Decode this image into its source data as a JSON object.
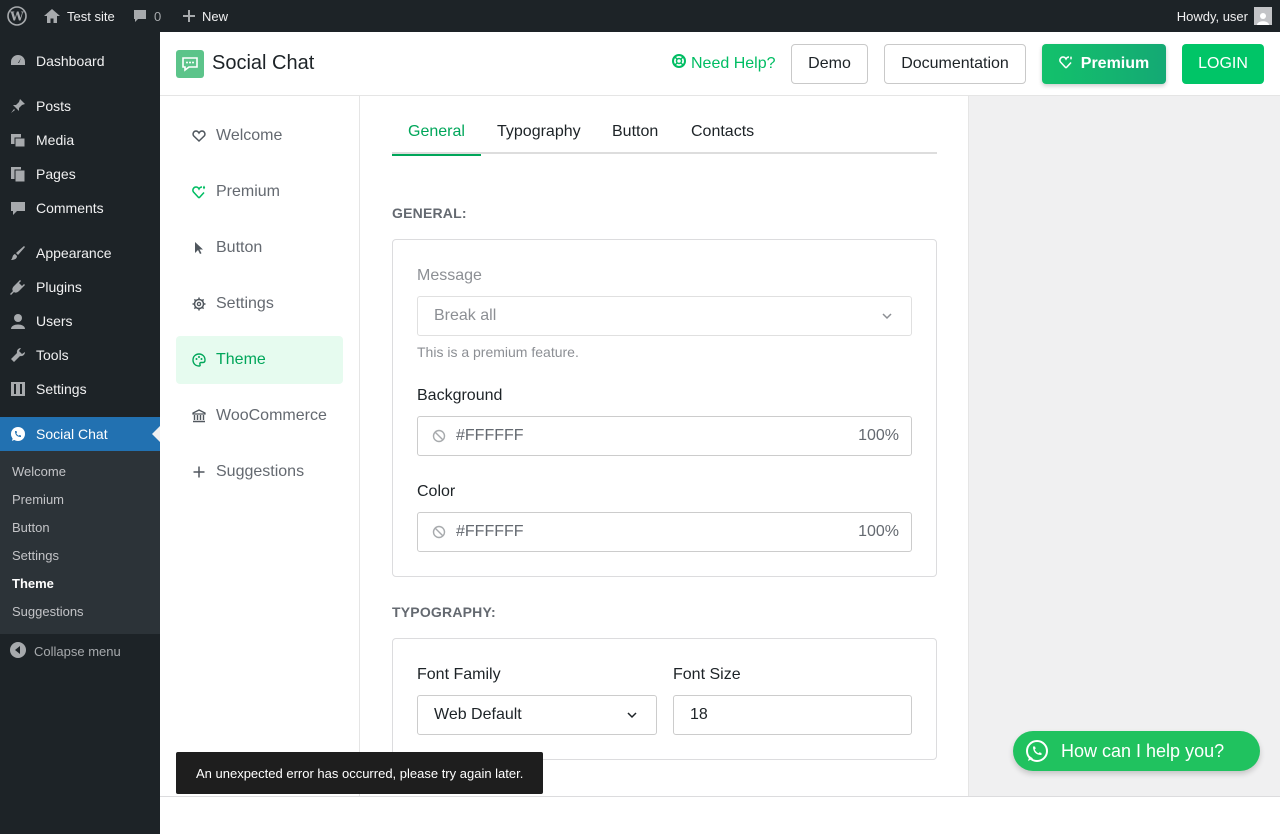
{
  "admin_bar": {
    "site_name": "Test site",
    "comments_count": "0",
    "new_label": "New",
    "howdy": "Howdy, user"
  },
  "admin_menu": {
    "items": [
      {
        "label": "Dashboard",
        "icon": "dashboard-icon"
      },
      {
        "label": "Posts",
        "icon": "pin-icon"
      },
      {
        "label": "Media",
        "icon": "media-icon"
      },
      {
        "label": "Pages",
        "icon": "pages-icon"
      },
      {
        "label": "Comments",
        "icon": "comment-icon"
      },
      {
        "label": "Appearance",
        "icon": "brush-icon"
      },
      {
        "label": "Plugins",
        "icon": "plug-icon"
      },
      {
        "label": "Users",
        "icon": "user-icon"
      },
      {
        "label": "Tools",
        "icon": "wrench-icon"
      },
      {
        "label": "Settings",
        "icon": "sliders-icon"
      },
      {
        "label": "Social Chat",
        "icon": "whatsapp-icon"
      }
    ],
    "submenu": [
      "Welcome",
      "Premium",
      "Button",
      "Settings",
      "Theme",
      "Suggestions"
    ],
    "collapse_label": "Collapse menu"
  },
  "header": {
    "title": "Social Chat",
    "help_label": "Need Help?",
    "demo_label": "Demo",
    "docs_label": "Documentation",
    "premium_label": "Premium",
    "login_label": "LOGIN",
    "accent_color": "#00bd63"
  },
  "plugin_nav": {
    "items": [
      {
        "label": "Welcome",
        "icon": "heart-icon"
      },
      {
        "label": "Premium",
        "icon": "diamond-heart-icon"
      },
      {
        "label": "Button",
        "icon": "pointer-icon"
      },
      {
        "label": "Settings",
        "icon": "gear-icon"
      },
      {
        "label": "Theme",
        "icon": "palette-icon"
      },
      {
        "label": "WooCommerce",
        "icon": "bank-icon"
      },
      {
        "label": "Suggestions",
        "icon": "plus-icon"
      }
    ],
    "active": "Theme"
  },
  "tabs": [
    "General",
    "Typography",
    "Button",
    "Contacts"
  ],
  "general": {
    "section_title": "GENERAL:",
    "message_label": "Message",
    "message_value": "Break all",
    "message_help": "This is a premium feature.",
    "background_label": "Background",
    "background_value": "#FFFFFF",
    "background_opacity": "100%",
    "color_label": "Color",
    "color_value": "#FFFFFF",
    "color_opacity": "100%"
  },
  "typography": {
    "section_title": "TYPOGRAPHY:",
    "font_family_label": "Font Family",
    "font_family_value": "Web Default",
    "font_size_label": "Font Size",
    "font_size_value": "18"
  },
  "snackbar": "An unexpected error has occurred, please try again later.",
  "whatsapp_cta": "How can I help you?"
}
